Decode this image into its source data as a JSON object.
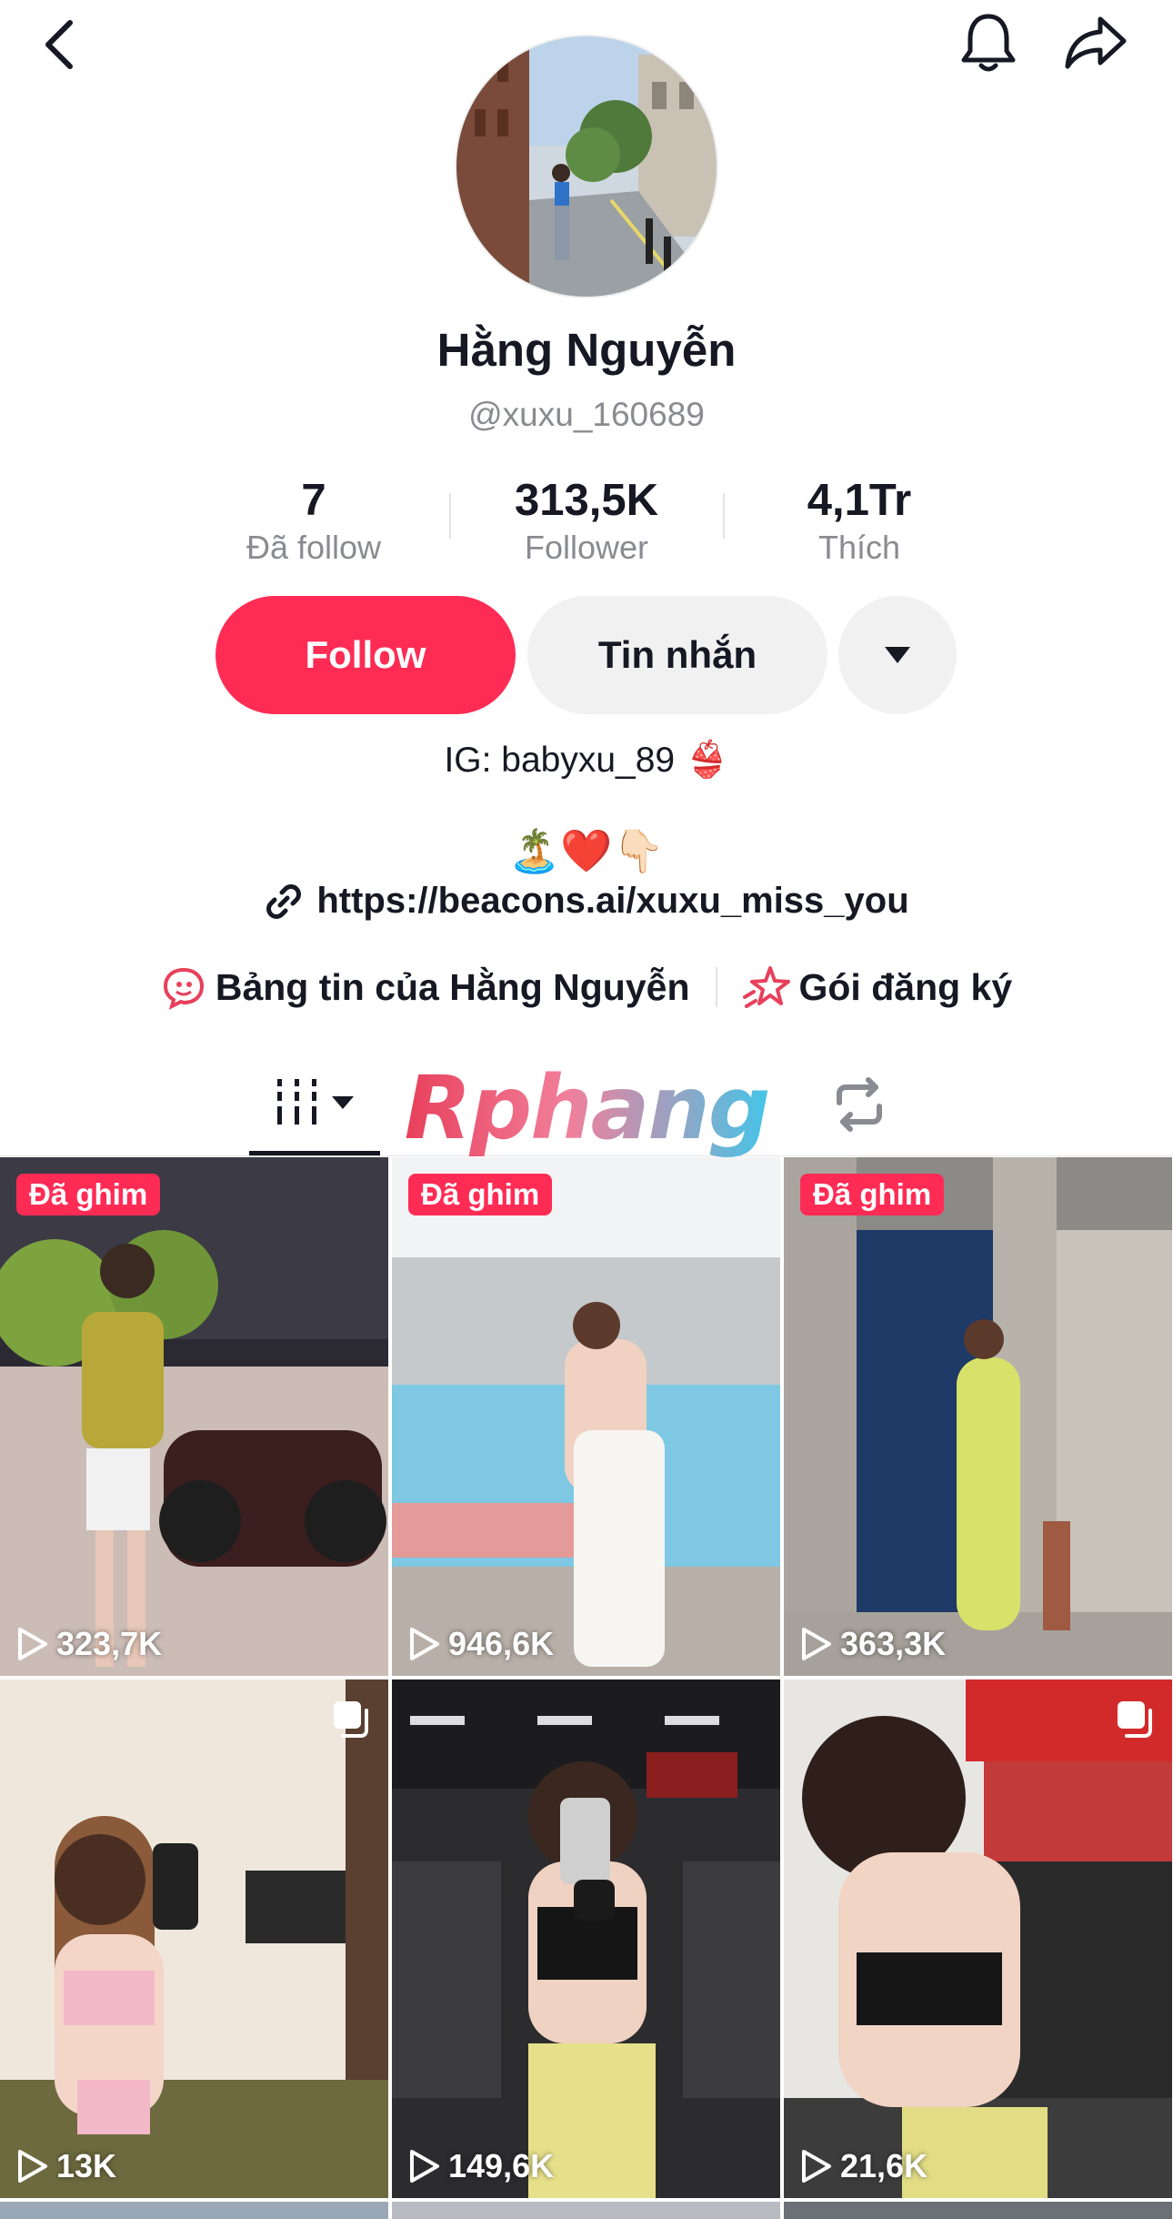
{
  "header": {
    "back_icon": "chevron-left-icon",
    "bell_icon": "bell-icon",
    "share_icon": "share-arrow-icon"
  },
  "profile": {
    "name": "Hằng Nguyễn",
    "handle": "@xuxu_160689",
    "stats": [
      {
        "value": "7",
        "label": "Đã follow"
      },
      {
        "value": "313,5K",
        "label": "Follower"
      },
      {
        "value": "4,1Tr",
        "label": "Thích"
      }
    ]
  },
  "actions": {
    "follow_label": "Follow",
    "message_label": "Tin nhắn"
  },
  "bio": {
    "line1": "IG: babyxu_89 👙",
    "line2": "🏝️❤️👇🏻",
    "link": "https://beacons.ai/xuxu_miss_you"
  },
  "subs": {
    "feed_label": "Bảng tin của Hằng Nguyễn",
    "plan_label": "Gói đăng ký"
  },
  "watermark": "Rphang",
  "videos": [
    {
      "pinned": "Đã ghim",
      "views": "323,7K"
    },
    {
      "pinned": "Đã ghim",
      "views": "946,6K"
    },
    {
      "pinned": "Đã ghim",
      "views": "363,3K"
    },
    {
      "pinned": "",
      "views": "13K"
    },
    {
      "pinned": "",
      "views": "149,6K"
    },
    {
      "pinned": "",
      "views": "21,6K"
    }
  ],
  "colors": {
    "accent": "#FE2C55",
    "text": "#161823",
    "muted": "#8A8B91"
  }
}
